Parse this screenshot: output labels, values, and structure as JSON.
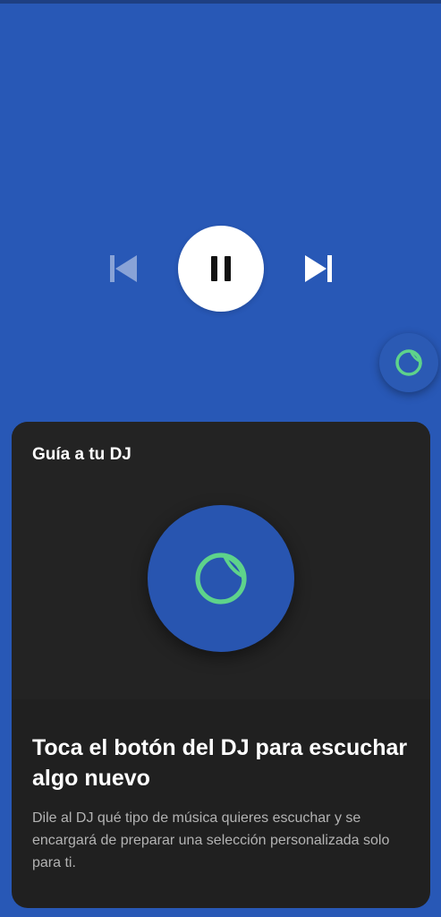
{
  "player": {
    "prev_icon": "skip-previous-icon",
    "play_pause_icon": "pause-icon",
    "next_icon": "skip-next-icon",
    "dj_icon": "dj-icon",
    "accent_color": "#5ed38b",
    "background_color": "#2858b6"
  },
  "dj_card": {
    "heading": "Guía a tu DJ",
    "title": "Toca el botón del DJ para escuchar algo nuevo",
    "body": "Dile al DJ qué tipo de música quieres escuchar y se encargará de preparar una selección personalizada solo para ti.",
    "card_color": "#202020"
  }
}
